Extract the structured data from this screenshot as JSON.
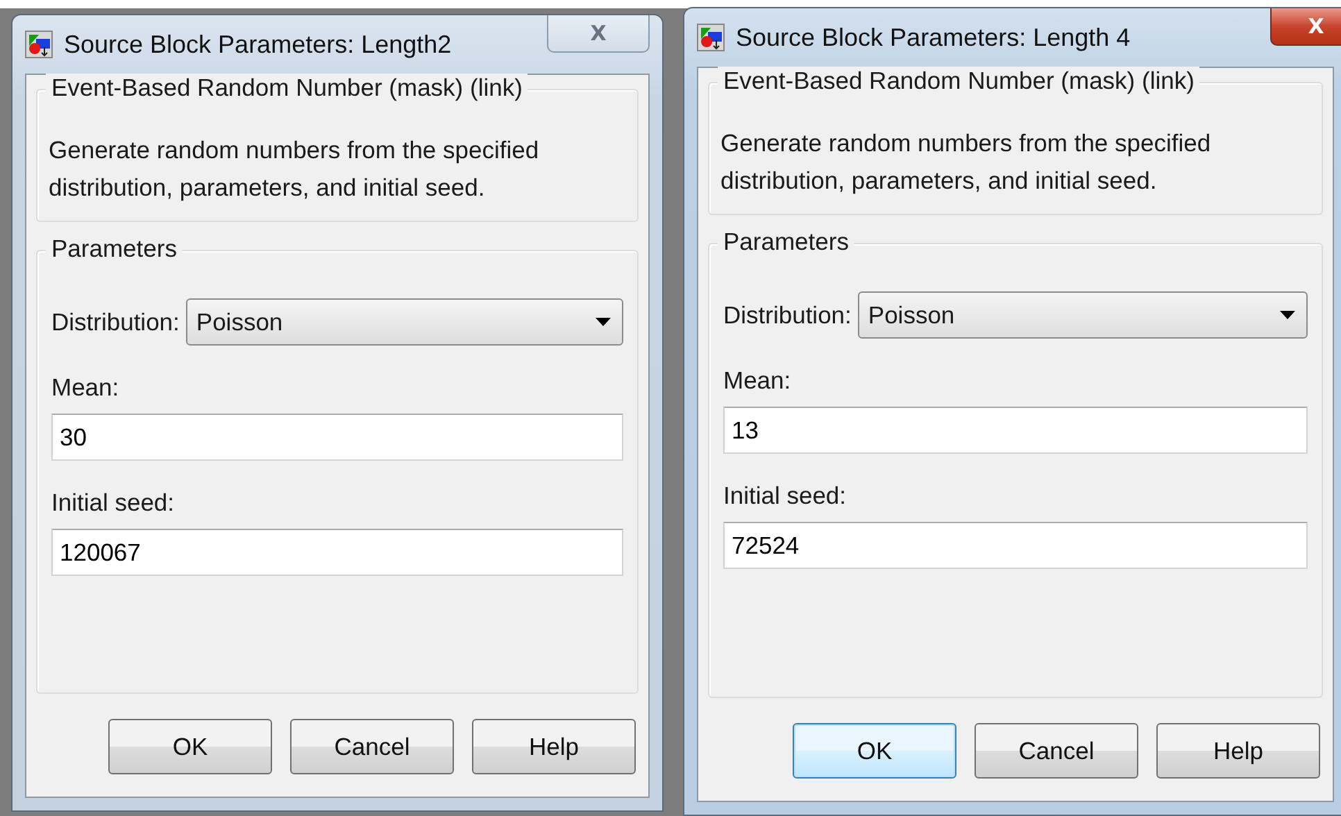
{
  "windows": [
    {
      "title": "Source Block Parameters: Length2",
      "active": false,
      "close": "X",
      "description_group": {
        "title": "Event-Based Random Number (mask) (link)",
        "text": "Generate random numbers from the specified distribution, parameters, and initial seed."
      },
      "parameters": {
        "title": "Parameters",
        "distribution_label": "Distribution:",
        "distribution": "Poisson",
        "mean_label": "Mean:",
        "mean": "30",
        "seed_label": "Initial seed:",
        "seed": "120067"
      },
      "buttons": [
        {
          "label": "OK",
          "focused": false
        },
        {
          "label": "Cancel",
          "focused": false
        },
        {
          "label": "Help",
          "focused": false
        }
      ]
    },
    {
      "title": "Source Block Parameters: Length 4",
      "active": true,
      "close": "X",
      "description_group": {
        "title": "Event-Based Random Number (mask) (link)",
        "text": "Generate random numbers from the specified distribution, parameters, and initial seed."
      },
      "parameters": {
        "title": "Parameters",
        "distribution_label": "Distribution:",
        "distribution": "Poisson",
        "mean_label": "Mean:",
        "mean": "13",
        "seed_label": "Initial seed:",
        "seed": "72524"
      },
      "buttons": [
        {
          "label": "OK",
          "focused": true
        },
        {
          "label": "Cancel",
          "focused": false
        },
        {
          "label": "Help",
          "focused": false
        }
      ]
    }
  ]
}
